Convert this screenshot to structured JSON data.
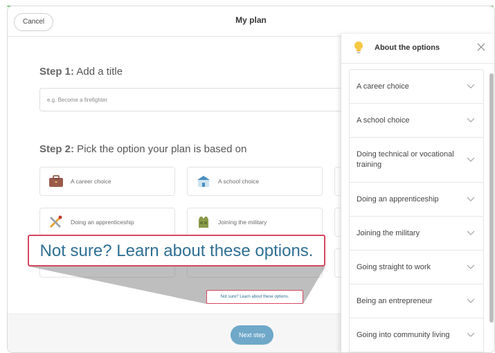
{
  "header": {
    "cancel_label": "Cancel",
    "title": "My plan"
  },
  "step1": {
    "prefix": "Step 1:",
    "text": " Add a title",
    "placeholder": "e.g. Become a firefighter"
  },
  "step2": {
    "prefix": "Step 2:",
    "text": " Pick the option your plan is based on"
  },
  "options": [
    {
      "label": "A career choice",
      "icon": "briefcase-icon"
    },
    {
      "label": "A school choice",
      "icon": "school-icon"
    },
    {
      "label": "Doing an apprenticeship",
      "icon": "tools-icon"
    },
    {
      "label": "Joining the military",
      "icon": "military-vest-icon"
    }
  ],
  "callout": {
    "big_text": "Not sure? Learn about these options.",
    "small_text": "Not sure? Learn about these options."
  },
  "footer": {
    "next_label": "Next step"
  },
  "panel": {
    "title": "About the options",
    "icon": "lightbulb-icon",
    "items": [
      "A career choice",
      "A school choice",
      "Doing technical or vocational training",
      "Doing an apprenticeship",
      "Joining the military",
      "Going straight to work",
      "Being an entrepreneur",
      "Going into community living"
    ]
  },
  "colors": {
    "accent": "#2f6f93",
    "highlight": "#d7475f",
    "button": "#6fa8c9",
    "topline": "#7cc37a"
  }
}
